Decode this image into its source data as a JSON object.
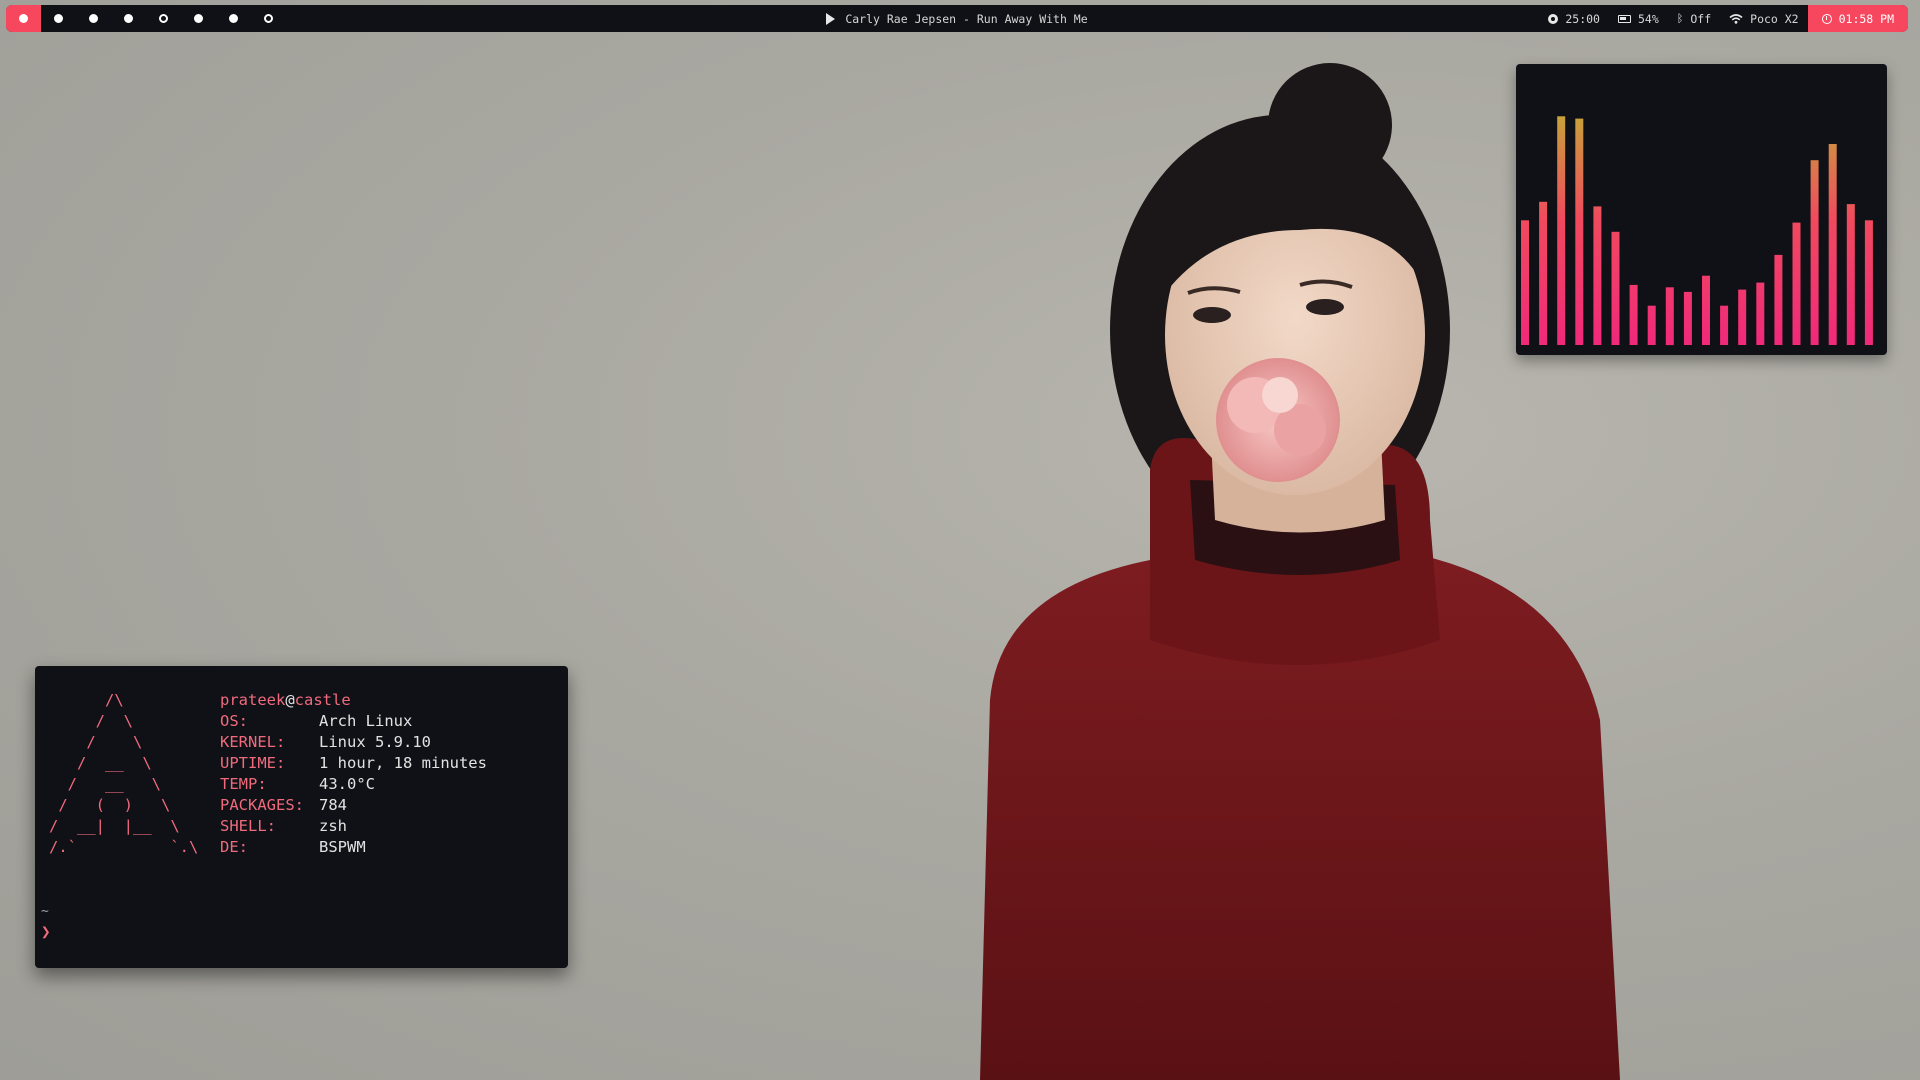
{
  "topbar": {
    "workspaces": [
      {
        "state": "active"
      },
      {
        "state": "occupied"
      },
      {
        "state": "occupied"
      },
      {
        "state": "occupied"
      },
      {
        "state": "empty"
      },
      {
        "state": "occupied"
      },
      {
        "state": "occupied"
      },
      {
        "state": "empty"
      }
    ],
    "now_playing": "Carly Rae Jepsen - Run Away With Me",
    "timer": "25:00",
    "battery": "54%",
    "bluetooth": "Off",
    "wifi": "Poco X2",
    "clock": "01:58 PM",
    "accent_color": "#f6475f",
    "icons": [
      "play-icon",
      "timer-icon",
      "battery-icon",
      "bluetooth-icon",
      "wifi-icon",
      "clock-icon"
    ]
  },
  "visualizer": {
    "bar_levels": [
      0.54,
      0.62,
      0.99,
      0.98,
      0.6,
      0.49,
      0.26,
      0.17,
      0.25,
      0.23,
      0.3,
      0.17,
      0.24,
      0.27,
      0.39,
      0.53,
      0.8,
      0.87,
      0.61,
      0.54
    ],
    "colors": {
      "low": "#f0297a",
      "mid": "#f04a5e",
      "high": "#c8a23a"
    }
  },
  "terminal": {
    "ascii_art": "      /\\\n     /  \\\n    /    \\\n   /  __  \\\n  /   __   \\\n /   (  )   \\\n/  __|  |__  \\\n/.`          `.\\",
    "user": "prateek",
    "at": "@",
    "host": "castle",
    "info": [
      {
        "key": "OS:",
        "value": "Arch Linux"
      },
      {
        "key": "KERNEL:",
        "value": "Linux 5.9.10"
      },
      {
        "key": "UPTIME:",
        "value": "1 hour, 18 minutes"
      },
      {
        "key": "TEMP:",
        "value": "43.0°C"
      },
      {
        "key": "PACKAGES:",
        "value": "784"
      },
      {
        "key": "SHELL:",
        "value": "zsh"
      },
      {
        "key": "DE:",
        "value": "BSPWM"
      }
    ],
    "prompt_dir": "~",
    "prompt_symbol": "❯"
  }
}
